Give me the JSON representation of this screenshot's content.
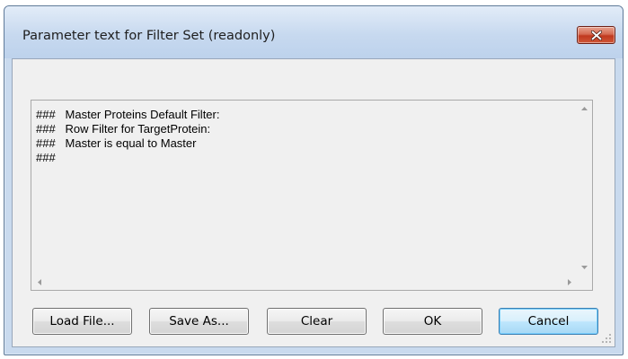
{
  "window": {
    "title": "Parameter text for Filter Set (readonly)",
    "close_icon": "close-icon"
  },
  "textarea": {
    "lines": [
      "###   Master Proteins Default Filter:",
      "###   Row Filter for TargetProtein:",
      "###   Master is equal to Master",
      "###"
    ],
    "readonly": true
  },
  "buttons": {
    "load_file": "Load File...",
    "save_as": "Save As...",
    "clear": "Clear",
    "ok": "OK",
    "cancel": "Cancel"
  },
  "colors": {
    "close_button": "#c7432a",
    "default_button_border": "#3c7fb1",
    "client_background": "#f0f0f0"
  }
}
